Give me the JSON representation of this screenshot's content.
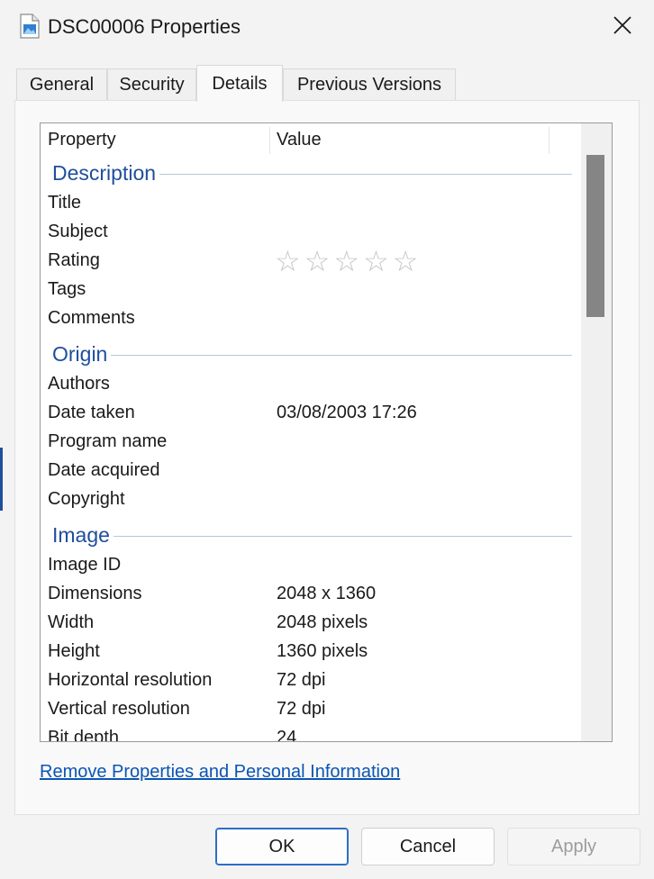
{
  "window": {
    "title": "DSC00006 Properties",
    "icon": "image-file-icon"
  },
  "tabs": [
    {
      "label": "General",
      "active": false
    },
    {
      "label": "Security",
      "active": false
    },
    {
      "label": "Details",
      "active": true
    },
    {
      "label": "Previous Versions",
      "active": false
    }
  ],
  "details": {
    "columns": {
      "property": "Property",
      "value": "Value"
    },
    "groups": {
      "description": {
        "label": "Description",
        "rows": [
          {
            "property": "Title",
            "value": ""
          },
          {
            "property": "Subject",
            "value": ""
          },
          {
            "property": "Rating",
            "value": "",
            "stars_total": 5,
            "stars_filled": 0
          },
          {
            "property": "Tags",
            "value": ""
          },
          {
            "property": "Comments",
            "value": ""
          }
        ]
      },
      "origin": {
        "label": "Origin",
        "rows": [
          {
            "property": "Authors",
            "value": ""
          },
          {
            "property": "Date taken",
            "value": "03/08/2003 17:26"
          },
          {
            "property": "Program name",
            "value": ""
          },
          {
            "property": "Date acquired",
            "value": ""
          },
          {
            "property": "Copyright",
            "value": ""
          }
        ]
      },
      "image": {
        "label": "Image",
        "rows": [
          {
            "property": "Image ID",
            "value": ""
          },
          {
            "property": "Dimensions",
            "value": "2048 x 1360"
          },
          {
            "property": "Width",
            "value": "2048 pixels"
          },
          {
            "property": "Height",
            "value": "1360 pixels"
          },
          {
            "property": "Horizontal resolution",
            "value": "72 dpi"
          },
          {
            "property": "Vertical resolution",
            "value": "72 dpi"
          },
          {
            "property": "Bit depth",
            "value": "24"
          }
        ]
      }
    }
  },
  "link": {
    "label": "Remove Properties and Personal Information"
  },
  "buttons": {
    "ok": "OK",
    "cancel": "Cancel",
    "apply": "Apply"
  },
  "colors": {
    "accent": "#1f4e9c",
    "link": "#0b55b3",
    "primary_border": "#2a6fc9"
  }
}
